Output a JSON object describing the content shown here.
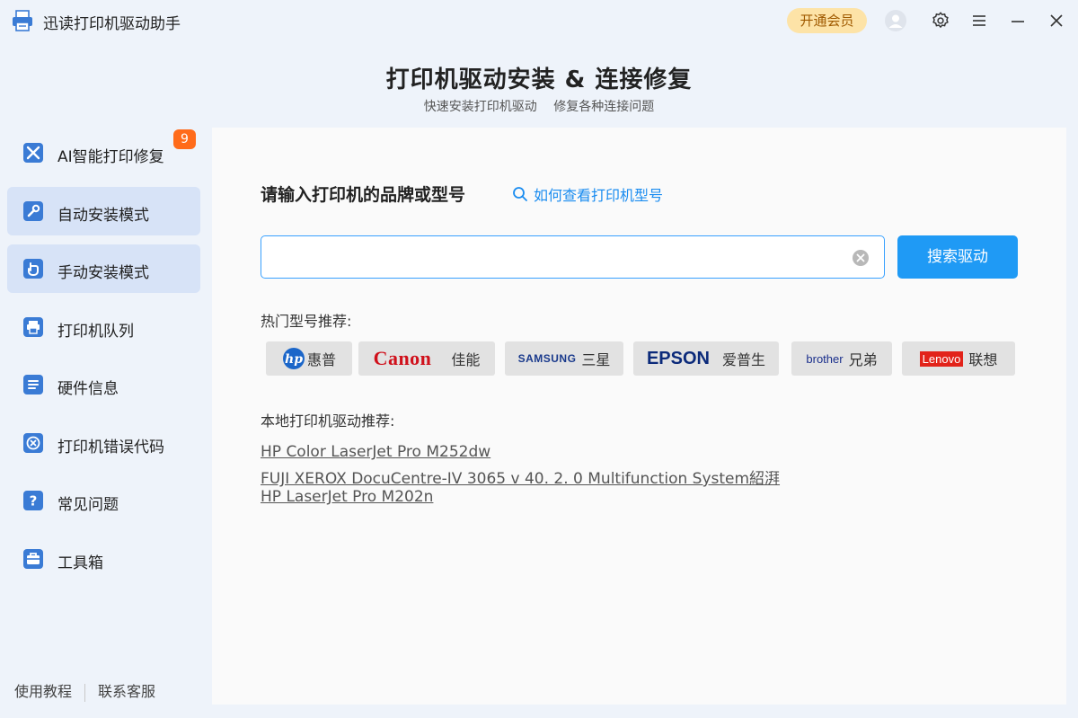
{
  "app": {
    "title": "迅读打印机驱动助手",
    "vip_label": "开通会员"
  },
  "header": {
    "title": "打印机驱动安装 & 连接修复",
    "subtitle": "快速安装打印机驱动 修复各种连接问题"
  },
  "sidebar": {
    "badge": "9",
    "items": [
      {
        "label": "AI智能打印修复",
        "icon": "wrench-cross-icon"
      },
      {
        "label": "自动安装模式",
        "icon": "wrench-icon"
      },
      {
        "label": "手动安装模式",
        "icon": "hand-icon"
      },
      {
        "label": "打印机队列",
        "icon": "printer-icon"
      },
      {
        "label": "硬件信息",
        "icon": "document-icon"
      },
      {
        "label": "打印机错误代码",
        "icon": "error-x-icon"
      },
      {
        "label": "常见问题",
        "icon": "question-icon"
      },
      {
        "label": "工具箱",
        "icon": "toolbox-icon"
      }
    ],
    "footer": {
      "tutorial": "使用教程",
      "support": "联系客服"
    }
  },
  "main": {
    "search_label": "请输入打印机的品牌或型号",
    "help_link": "如何查看打印机型号",
    "search_value": "",
    "search_button": "搜索驱动",
    "hot_label": "热门型号推荐:",
    "brands": [
      {
        "logo": "hp",
        "name": "惠普"
      },
      {
        "logo": "Canon",
        "name": "佳能"
      },
      {
        "logo": "SAMSUNG",
        "name": "三星"
      },
      {
        "logo": "EPSON",
        "name": "爱普生"
      },
      {
        "logo": "brother",
        "name": "兄弟"
      },
      {
        "logo": "Lenovo",
        "name": "联想"
      }
    ],
    "local_label": "本地打印机驱动推荐:",
    "local_drivers": [
      "HP Color LaserJet Pro M252dw",
      "FUJI XEROX DocuCentre-IV 3065  v 40. 2. 0 Multifunction System紹湃",
      "HP LaserJet Pro M202n"
    ]
  },
  "colors": {
    "accent": "#1f9af5",
    "badge": "#ff6b1a",
    "vip_bg": "#fde3a7",
    "sidebar_active": "#d7e3f7"
  }
}
